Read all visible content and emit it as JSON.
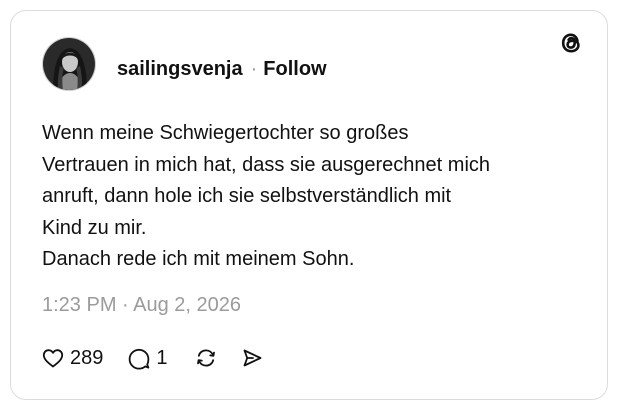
{
  "post": {
    "author": {
      "username": "sailingsvenja",
      "separator": "·",
      "follow_label": "Follow",
      "avatar_icon": "profile-photo"
    },
    "brand_icon": "threads-logo-icon",
    "body_lines": [
      "Wenn meine Schwiegertochter so großes",
      "Vertrauen in mich hat, dass sie ausgerechnet mich",
      "anruft, dann hole ich sie selbstverständlich mit",
      "Kind zu mir.",
      "Danach rede ich mit meinem Sohn."
    ],
    "timestamp": "1:23 PM · Aug 2, 2026",
    "actions": {
      "like": {
        "icon": "heart-icon",
        "count": "289"
      },
      "reply": {
        "icon": "comment-icon",
        "count": "1"
      },
      "repost": {
        "icon": "repost-icon"
      },
      "share": {
        "icon": "send-icon"
      }
    }
  },
  "colors": {
    "text": "#111111",
    "muted": "#9b9b9b",
    "border": "#dcdcdc",
    "background": "#ffffff"
  }
}
